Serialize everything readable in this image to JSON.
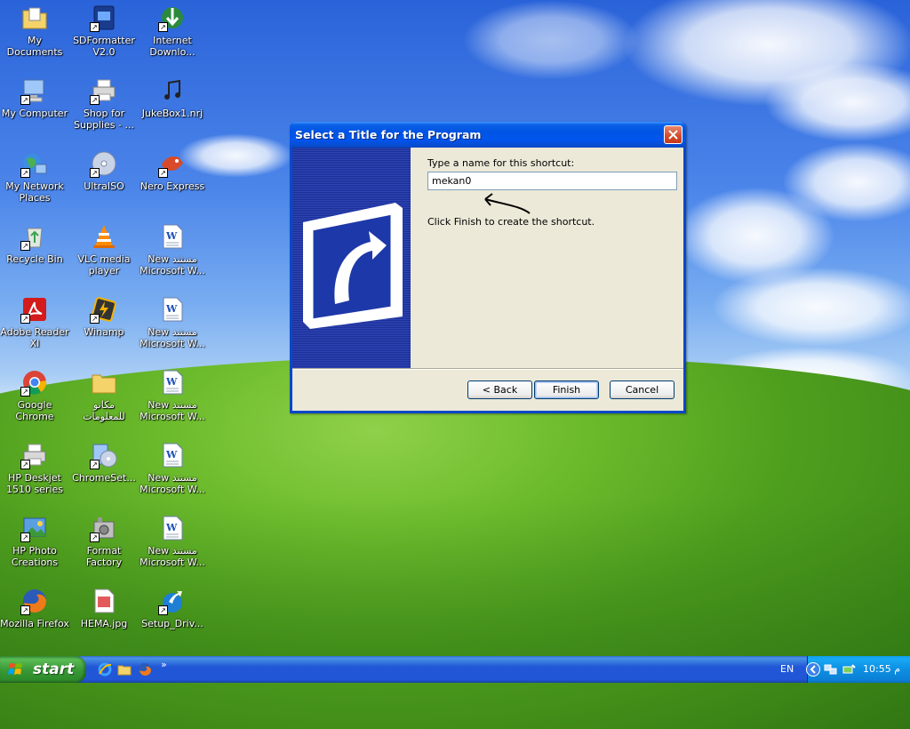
{
  "desktop": {
    "icons": [
      {
        "label": "My Documents",
        "icon": "folder-documents-icon"
      },
      {
        "label": "SDFormatter\nV2.0",
        "icon": "sd-card-icon"
      },
      {
        "label": "Internet\nDownlo...",
        "icon": "download-globe-icon"
      },
      {
        "label": "My Computer",
        "icon": "computer-icon"
      },
      {
        "label": "Shop for\nSupplies - ...",
        "icon": "printer-icon"
      },
      {
        "label": "JukeBox1.nrj",
        "icon": "music-file-icon"
      },
      {
        "label": "My Network\nPlaces",
        "icon": "network-globe-icon"
      },
      {
        "label": "UltraISO",
        "icon": "disc-icon"
      },
      {
        "label": "Nero Express",
        "icon": "nero-icon"
      },
      {
        "label": "Recycle Bin",
        "icon": "recycle-bin-icon"
      },
      {
        "label": "VLC media\nplayer",
        "icon": "vlc-cone-icon"
      },
      {
        "label": "New مستند\nMicrosoft W...",
        "icon": "word-doc-icon"
      },
      {
        "label": "Adobe Reader\nXI",
        "icon": "adobe-reader-icon"
      },
      {
        "label": "Winamp",
        "icon": "winamp-icon"
      },
      {
        "label": "New مستند\nMicrosoft W...",
        "icon": "word-doc-icon"
      },
      {
        "label": "Google Chrome",
        "icon": "chrome-icon"
      },
      {
        "label": "مكانو\nللمعلومات",
        "icon": "folder-icon"
      },
      {
        "label": "New مستند\nMicrosoft W...",
        "icon": "word-doc-icon"
      },
      {
        "label": "HP Deskjet\n1510 series",
        "icon": "printer-icon"
      },
      {
        "label": "ChromeSet...",
        "icon": "setup-disc-icon"
      },
      {
        "label": "New مستند\nMicrosoft W...",
        "icon": "word-doc-icon"
      },
      {
        "label": "HP Photo\nCreations",
        "icon": "photo-icon"
      },
      {
        "label": "Format Factory",
        "icon": "format-factory-icon"
      },
      {
        "label": "New مستند\nMicrosoft W...",
        "icon": "word-doc-icon"
      },
      {
        "label": "Mozilla Firefox",
        "icon": "firefox-icon"
      },
      {
        "label": "HEMA.jpg",
        "icon": "image-file-icon"
      },
      {
        "label": "Setup_Driv...",
        "icon": "setup-arrow-icon"
      }
    ]
  },
  "dialog": {
    "title": "Select a Title for the Program",
    "prompt": "Type a name for this shortcut:",
    "name_value": "mekan0",
    "hint": "Click Finish to create the shortcut.",
    "back_label": "< Back",
    "finish_label": "Finish",
    "cancel_label": "Cancel"
  },
  "taskbar": {
    "start_label": "start",
    "quick_launch": [
      "ie-icon",
      "folder-icon",
      "firefox-icon"
    ],
    "overflow": "»",
    "language": "EN",
    "clock": "10:55 م"
  }
}
